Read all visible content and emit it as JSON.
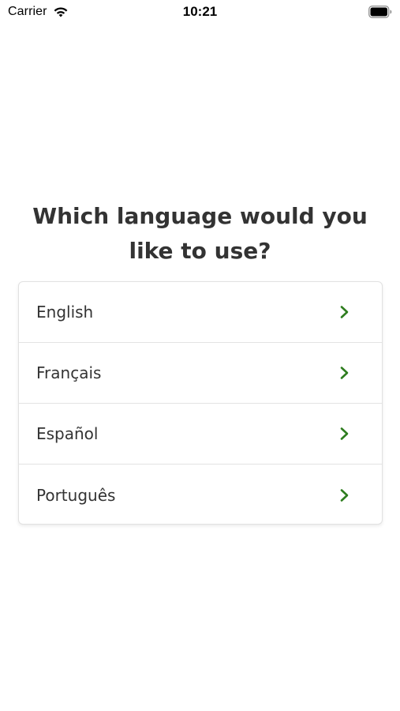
{
  "status_bar": {
    "carrier": "Carrier",
    "time": "10:21",
    "icons": [
      "wifi-icon",
      "battery-icon"
    ]
  },
  "prompt": {
    "title": "Which language would you like to use?"
  },
  "languages": [
    {
      "label": "English",
      "icon": "chevron-right-icon"
    },
    {
      "label": "Français",
      "icon": "chevron-right-icon"
    },
    {
      "label": "Español",
      "icon": "chevron-right-icon"
    },
    {
      "label": "Português",
      "icon": "chevron-right-icon"
    }
  ],
  "colors": {
    "accent": "#2e7d1f",
    "text": "#333333",
    "divider": "#e3e3e3",
    "background": "#ffffff"
  }
}
